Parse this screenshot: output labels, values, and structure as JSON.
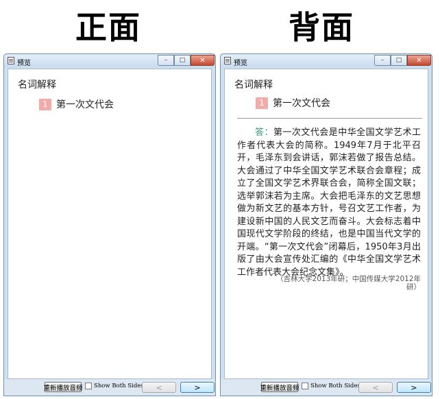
{
  "labels": {
    "front": "正面",
    "back": "背面"
  },
  "window": {
    "title": "预览",
    "minimize": "–",
    "maximize": "□",
    "close": "✕"
  },
  "card": {
    "heading": "名词解释",
    "number": "1",
    "question": "第一次文代会",
    "answer_label": "答：",
    "answer_body": "第一次文代会是中华全国文学艺术工作者代表大会的简称。1949年7月于北平召开，毛泽东到会讲话，郭沫若做了报告总结。大会通过了中华全国文学艺术联合会章程；成立了全国文学艺术界联合会，简称全国文联；选举郭沫若为主席。大会把毛泽东的文艺思想做为新文艺的基本方针，号召文艺工作者，为建设新中国的人民文艺而奋斗。大会标志着中国现代文学阶段的终结，也是中国当代文学的开端。“第一次文代会”闭幕后，1950年3月出版了由大会宣传处汇编的《中华全国文学艺术工作者代表大会纪念文集》。",
    "source": "（吉林大学2013年研；中国传媒大学2012年研）"
  },
  "toolbar": {
    "replay_label": "重新播放音频",
    "show_both_label": "Show Both Sides",
    "show_both_checked": false,
    "prev_label": "<",
    "next_label": ">"
  }
}
